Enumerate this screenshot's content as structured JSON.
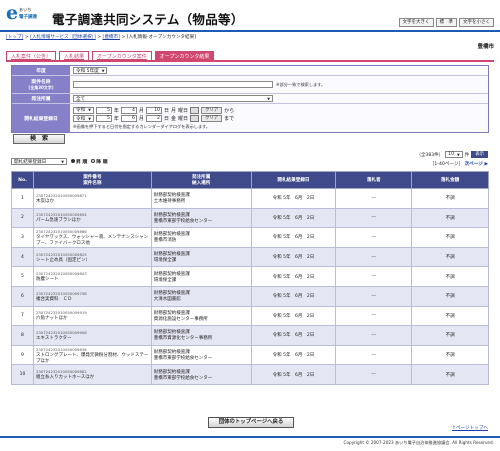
{
  "header": {
    "logo_mark": "e",
    "logo_sub_top": "あいち",
    "logo_sub_bottom": "電子調達",
    "title": "電子調達共同システム（物品等）",
    "font_buttons": [
      "文字を大きく",
      "標　準",
      "文字を小さく"
    ]
  },
  "breadcrumb": {
    "items": [
      "[トップ]",
      "[入札情報サービス（団体選択）]",
      "[豊橋市]"
    ],
    "current": "[入札情報-オープンカウンタ結果]",
    "sep": " > "
  },
  "org_name": "豊橋市",
  "tabs": [
    "入札案件（公告）",
    "入札結果",
    "オープンカウンタ案件",
    "オープンカウンタ結果"
  ],
  "form": {
    "year_label": "年度",
    "year_value": "令和 5年度",
    "case_label": "案件名称",
    "case_label_sub": "(全角30文字)",
    "case_note": "※部分一致で検索します。",
    "order_label": "発注所属",
    "order_value": "全て",
    "date_label": "開札結果登録日",
    "from": {
      "era": "令和",
      "y": "5",
      "m": "4",
      "d": "10",
      "suffix": "から"
    },
    "to": {
      "era": "令和",
      "y": "5",
      "m": "6",
      "d": "2",
      "suffix": "まで"
    },
    "year_unit": "年",
    "month_unit": "月",
    "day_unit": "日",
    "weekday_from": "月",
    "weekday_to": "金",
    "yobi": "曜日",
    "clear": "クリア",
    "date_note": "※画像を押下すると日付を指定するカレンダーダイアログを表示します。",
    "search": "検　索"
  },
  "sort": {
    "select": "開札結果登録日",
    "asc": "昇 順",
    "desc": "降 順"
  },
  "count": {
    "text": "（全383件）",
    "per_page": "10",
    "unit": "件",
    "display": "表示"
  },
  "pager": {
    "range": "［1-40ページ］",
    "next": "次ページ ▶"
  },
  "table": {
    "headers": {
      "no": "No.",
      "case_top": "案件番号",
      "case_bottom": "案件名称",
      "dept_top": "発注所属",
      "dept_bottom": "納入場所",
      "date": "開札結果登録日",
      "winner": "落札者",
      "amount": "落札金額"
    },
    "rows": [
      {
        "no": "1",
        "id": "230724232010050009871",
        "name": "木炭ほか",
        "dept": "財務部契約検査課",
        "place": "土木維持事務所",
        "date": "令和 5年　6月　2日",
        "winner": "---",
        "amount": "不調"
      },
      {
        "no": "2",
        "id": "230724232010050009894",
        "name": "パーム急速ブラシほか",
        "dept": "財務部契約検査課",
        "place": "豊橋市東部学校給食センター",
        "date": "令和 5年　6月　2日",
        "winner": "---",
        "amount": "不調"
      },
      {
        "no": "3",
        "id": "230724232010050009866",
        "name": "タイヤワックス、ウォッシャー液、メンテナンスシャンプー、ファイバークロス他",
        "dept": "財務部契約検査課",
        "place": "豊橋市消防",
        "date": "令和 5年　6月　2日",
        "winner": "---",
        "amount": "不調"
      },
      {
        "no": "4",
        "id": "230724232010050009825",
        "name": "シート止め具（固定ピン）",
        "dept": "財務部契約検査課",
        "place": "環境保全課",
        "date": "令和 5年　6月　2日",
        "winner": "---",
        "amount": "不調"
      },
      {
        "no": "5",
        "id": "230724232010050009843",
        "name": "防塵シート",
        "dept": "財務部契約検査課",
        "place": "環境保全課",
        "date": "令和 5年　6月　2日",
        "winner": "---",
        "amount": "不調"
      },
      {
        "no": "6",
        "id": "230724232010050009758",
        "name": "複合実資料　ＣＤ",
        "dept": "財務部契約検査課",
        "place": "大清水図書館",
        "date": "令和 5年　6月　2日",
        "winner": "---",
        "amount": "不調"
      },
      {
        "no": "7",
        "id": "230724232010050009919",
        "name": "六角ナットほか",
        "dept": "財務部契約検査課",
        "place": "資源化施設センター事務所",
        "date": "令和 5年　6月　2日",
        "winner": "---",
        "amount": "不調"
      },
      {
        "no": "8",
        "id": "230724232010050009906",
        "name": "エキストラクター",
        "dept": "財務部契約検査課",
        "place": "豊橋市資源化センター事務所",
        "date": "令和 5年　6月　2日",
        "winner": "---",
        "amount": "不調"
      },
      {
        "no": "9",
        "id": "230724232010050009836",
        "name": "ストロングプレート、爆発元微粉分割材、ウッドステープほか",
        "dept": "財務部契約検査課",
        "place": "豊橋市東部学校給食センター",
        "date": "令和 5年　6月　2日",
        "winner": "---",
        "amount": "不調"
      },
      {
        "no": "10",
        "id": "230724232010050009882",
        "name": "組立糸入りカットホースほか",
        "dept": "財務部契約検査課",
        "place": "豊橋市東部学校給食センター",
        "date": "令和 5年　6月　2日",
        "winner": "---",
        "amount": "不調"
      }
    ]
  },
  "back_button": "団体のトップページへ戻る",
  "page_top": "↑ページトップへ",
  "copyright": "Copyright © 2007-2023 あいち電子自治体推進協議会. All Rights Reserved."
}
